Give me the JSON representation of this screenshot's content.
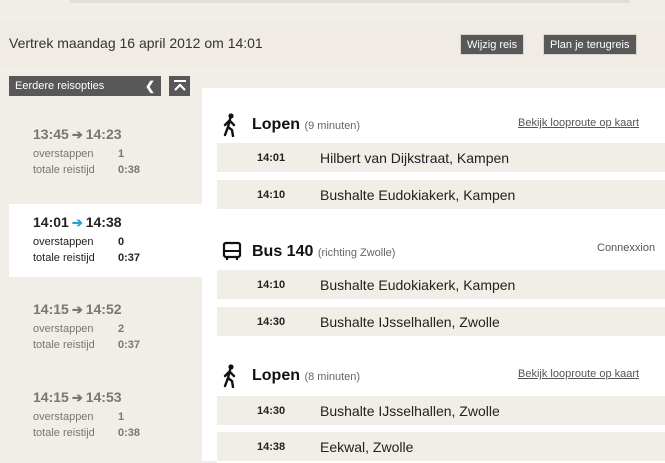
{
  "header": {
    "title": "Vertrek maandag 16 april 2012 om 14:01",
    "change_trip": "Wijzig reis",
    "plan_return": "Plan je terugreis"
  },
  "sidebar": {
    "earlier_label": "Eerdere reisopties",
    "options": [
      {
        "dep": "13:45",
        "arr": "14:23",
        "transfers_label": "overstappen",
        "transfers": "1",
        "duration_label": "totale reistijd",
        "duration": "0:38",
        "selected": false
      },
      {
        "dep": "14:01",
        "arr": "14:38",
        "transfers_label": "overstappen",
        "transfers": "0",
        "duration_label": "totale reistijd",
        "duration": "0:37",
        "selected": true
      },
      {
        "dep": "14:15",
        "arr": "14:52",
        "transfers_label": "overstappen",
        "transfers": "2",
        "duration_label": "totale reistijd",
        "duration": "0:37",
        "selected": false
      },
      {
        "dep": "14:15",
        "arr": "14:53",
        "transfers_label": "overstappen",
        "transfers": "1",
        "duration_label": "totale reistijd",
        "duration": "0:38",
        "selected": false
      }
    ]
  },
  "legs": [
    {
      "icon": "walk-icon",
      "mode": "Lopen",
      "detail": "(9 minuten)",
      "right": "Bekijk looproute op kaart",
      "stops": [
        {
          "time": "14:01",
          "place": "Hilbert van Dijkstraat, Kampen"
        },
        {
          "time": "14:10",
          "place": "Bushalte Eudokiakerk, Kampen"
        }
      ]
    },
    {
      "icon": "bus-icon",
      "mode": "Bus 140",
      "detail": "(richting Zwolle)",
      "right": "Connexxion",
      "stops": [
        {
          "time": "14:10",
          "place": "Bushalte Eudokiakerk, Kampen"
        },
        {
          "time": "14:30",
          "place": "Bushalte IJsselhallen, Zwolle"
        }
      ]
    },
    {
      "icon": "walk-icon",
      "mode": "Lopen",
      "detail": "(8 minuten)",
      "right": "Bekijk looproute op kaart",
      "stops": [
        {
          "time": "14:30",
          "place": "Bushalte IJsselhallen, Zwolle"
        },
        {
          "time": "14:38",
          "place": "Eekwal, Zwolle"
        }
      ]
    }
  ],
  "colors": {
    "accent_arrow": "#2a9fd6",
    "button_bg": "#585858",
    "page_bg": "#f1ede7"
  }
}
